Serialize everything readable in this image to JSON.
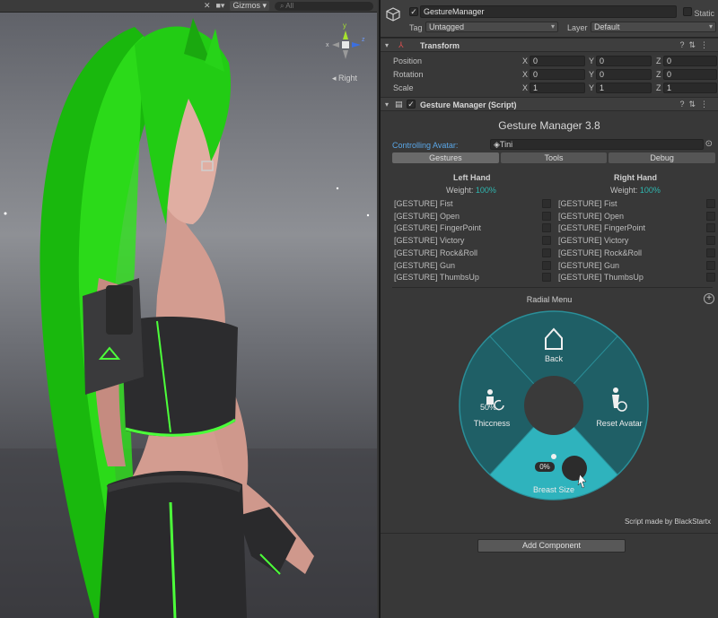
{
  "scene": {
    "toolbar_gizmos": "Gizmos",
    "toolbar_search": "All",
    "orientation_label": "Right",
    "gizmo_axes": {
      "y": "y",
      "x": "x",
      "z": "z"
    },
    "character_colors": {
      "hair": "#21d813",
      "outfit": "#2c2c2e",
      "trim": "#4cff3a",
      "skin": "#d9a397"
    }
  },
  "inspector": {
    "object_name": "GestureManager",
    "static_label": "Static",
    "tag_label": "Tag",
    "tag_value": "Untagged",
    "layer_label": "Layer",
    "layer_value": "Default",
    "transform": {
      "title": "Transform",
      "rows": [
        {
          "label": "Position",
          "x": "0",
          "y": "0",
          "z": "0"
        },
        {
          "label": "Rotation",
          "x": "0",
          "y": "0",
          "z": "0"
        },
        {
          "label": "Scale",
          "x": "1",
          "y": "1",
          "z": "1"
        }
      ],
      "axis_x": "X",
      "axis_y": "Y",
      "axis_z": "Z"
    },
    "script": {
      "title": "Gesture Manager (Script)",
      "header": "Gesture Manager 3.8",
      "controlling_label": "Controlling Avatar:",
      "controlling_value": "Tini",
      "tabs": [
        "Gestures",
        "Tools",
        "Debug"
      ],
      "active_tab": "Gestures",
      "left_hand": {
        "title": "Left Hand",
        "weight_label": "Weight:",
        "weight_value": "100%",
        "gestures": [
          "[GESTURE] Fist",
          "[GESTURE] Open",
          "[GESTURE] FingerPoint",
          "[GESTURE] Victory",
          "[GESTURE] Rock&Roll",
          "[GESTURE] Gun",
          "[GESTURE] ThumbsUp"
        ]
      },
      "right_hand": {
        "title": "Right Hand",
        "weight_label": "Weight:",
        "weight_value": "100%",
        "gestures": [
          "[GESTURE] Fist",
          "[GESTURE] Open",
          "[GESTURE] FingerPoint",
          "[GESTURE] Victory",
          "[GESTURE] Rock&Roll",
          "[GESTURE] Gun",
          "[GESTURE] ThumbsUp"
        ]
      },
      "radial_menu": {
        "title": "Radial Menu",
        "items": [
          {
            "label": "Back",
            "icon": "home-back-icon"
          },
          {
            "label": "Thiccness",
            "icon": "figure-icon",
            "value": "50%"
          },
          {
            "label": "Reset Avatar",
            "icon": "reset-figure-icon"
          },
          {
            "label": "Breast Size",
            "icon": "figure-icon",
            "value": "0%"
          }
        ],
        "active_item": "Breast Size",
        "ring_color": "#1f5f66",
        "active_color": "#2fb3bd"
      },
      "credit": "Script made by BlackStartx"
    },
    "add_component": "Add Component"
  }
}
